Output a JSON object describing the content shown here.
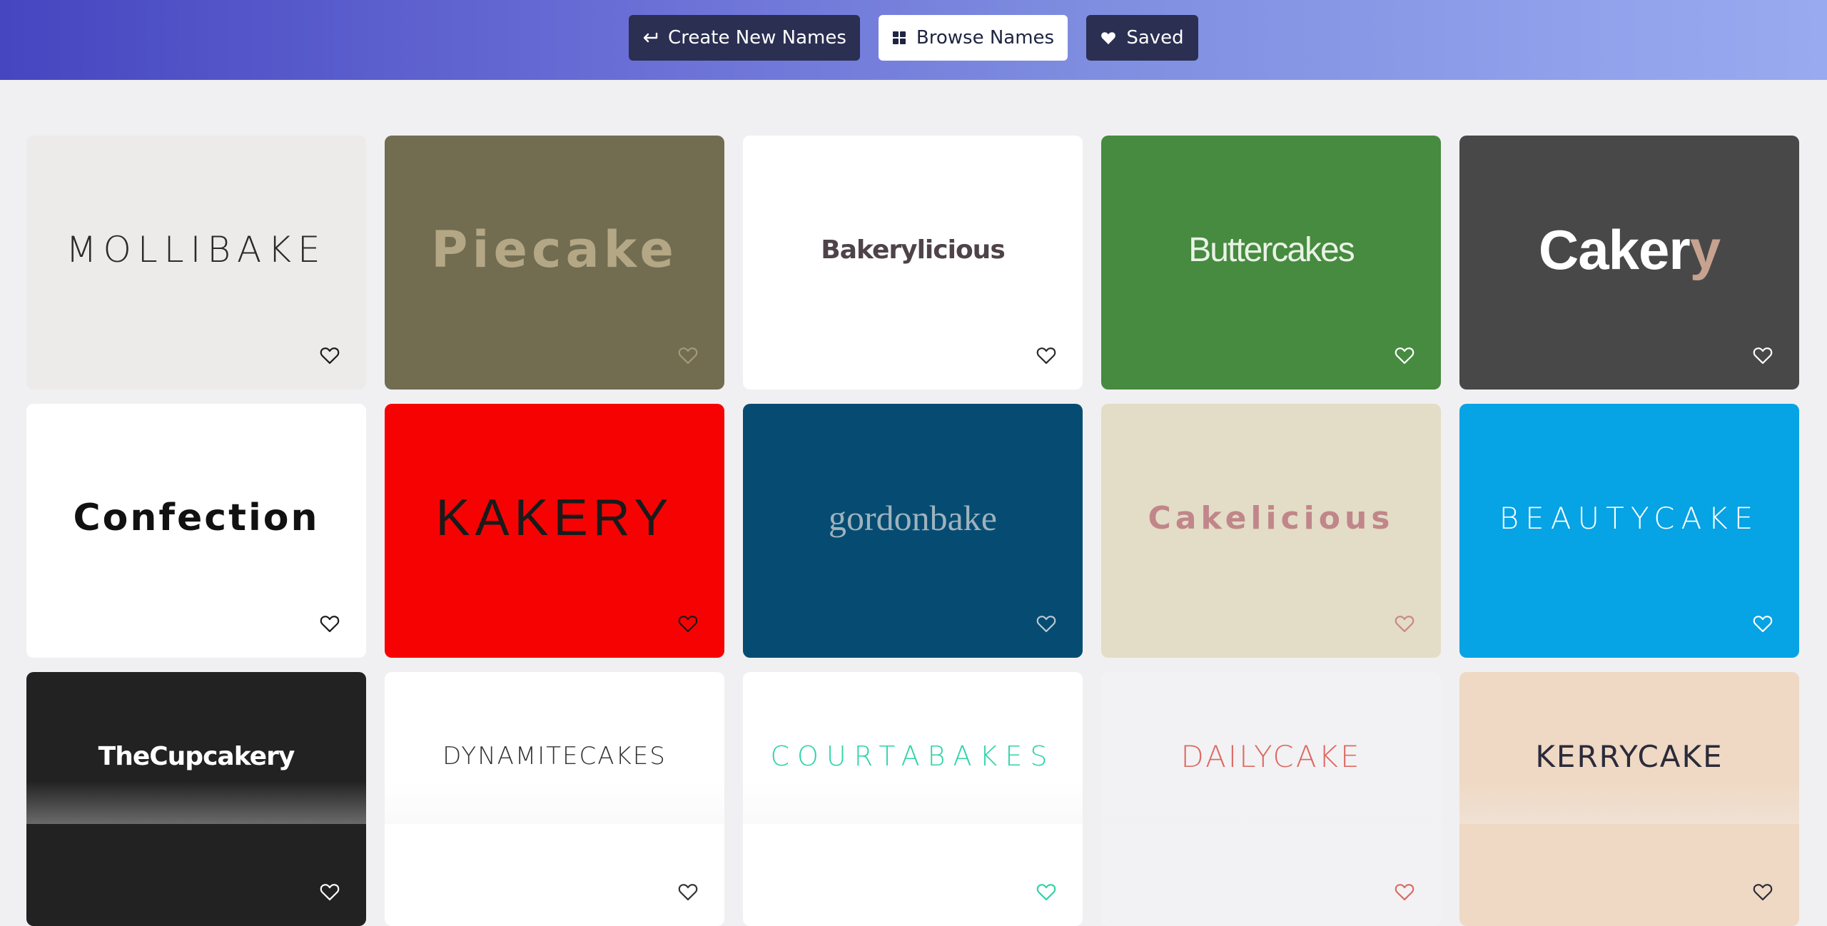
{
  "nav": {
    "create_label": "Create New Names",
    "browse_label": "Browse Names",
    "saved_label": "Saved"
  },
  "cards": [
    {
      "name": "MOLLIBAKE",
      "bg": "#ecebe9",
      "color": "#2a2a2a",
      "heart": "#1a1a1a"
    },
    {
      "name": "Piecake",
      "bg": "#726c51",
      "color": "#b3a785",
      "heart": "#a59a78"
    },
    {
      "name": "Bakerylicious",
      "bg": "#ffffff",
      "color": "#4d4348",
      "heart": "#2a2a2a"
    },
    {
      "name": "Buttercakes",
      "bg": "#468b3f",
      "color": "#eaf2e6",
      "heart": "#ffffff"
    },
    {
      "name": "Cakery",
      "bg": "#484848",
      "color": "#ffffff",
      "accent": "#c6a28f",
      "heart": "#ffffff"
    },
    {
      "name": "Confection",
      "bg": "#ffffff",
      "color": "#111111",
      "heart": "#1a1a1a"
    },
    {
      "name": "KAKERY",
      "bg": "#f70202",
      "color": "#1a1a1a",
      "heart": "#1a1a1a"
    },
    {
      "name": "gordonbake",
      "bg": "#064c72",
      "color": "#9fb2bd",
      "heart": "#b9c8d1"
    },
    {
      "name": "Cakelicious",
      "bg": "#e3dcc6",
      "color": "#c0868a",
      "heart": "#c9868d"
    },
    {
      "name": "BEAUTYCAKE",
      "bg": "#06a3e5",
      "color": "#ffffff",
      "heart": "#ffffff"
    },
    {
      "name": "TheCupcakery",
      "bg": "#222222",
      "color": "#ffffff",
      "heart": "#ffffff"
    },
    {
      "name": "DYNAMITECAKES",
      "bg": "#ffffff",
      "color": "#333333",
      "heart": "#333333"
    },
    {
      "name": "COURTABAKES",
      "bg": "#ffffff",
      "color": "#2fd3a8",
      "heart": "#2fd3a8"
    },
    {
      "name": "DAILYCAKE",
      "bg": "#f2f2f4",
      "color": "#dd6a63",
      "heart": "#dd6a63"
    },
    {
      "name": "KERRYCAKE",
      "bg": "#efd9c4",
      "color": "#2b2b3a",
      "heart": "#2b2b3a"
    }
  ]
}
